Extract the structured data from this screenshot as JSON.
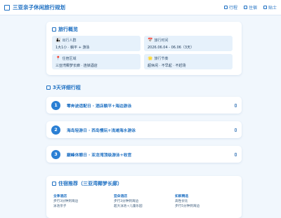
{
  "header": {
    "brand": "三亚亲子休闲旅行规划",
    "nav": [
      {
        "label": "行程"
      },
      {
        "label": "住宿"
      },
      {
        "label": "贴士"
      }
    ]
  },
  "overview": {
    "title": "旅行概览",
    "items": [
      {
        "label": "出行人群",
        "value": "1大1小 · 躺平 + 游泳",
        "icon": "🧑‍🧒"
      },
      {
        "label": "旅行时间",
        "value": "2026.06.04 - 06.06（3天）",
        "icon": "📅"
      },
      {
        "label": "住宿区域",
        "value": "三亚湾椰梦长廊 · 连锁酒店",
        "icon": "📍"
      },
      {
        "label": "旅行节奏",
        "value": "超休闲 · 不早起 · 不赶场",
        "icon": "🌟"
      }
    ]
  },
  "itinerary": {
    "title": "3天详细行程",
    "days": [
      {
        "num": "1",
        "text": "零奔波适配日 · 酒店躺平+海边游泳"
      },
      {
        "num": "2",
        "text": "海岛轻游日 · 西岛慢玩+浅滩海水游泳"
      },
      {
        "num": "3",
        "text": "巅峰休憩日 · 亚龙湾顶级游泳+收官"
      }
    ]
  },
  "hotels": {
    "title": "住宿推荐（三亚湾椰梦长廊）",
    "columns": [
      {
        "name": "全季酒店",
        "line1": "步行3分钟到海边",
        "line2": "泳池亲子"
      },
      {
        "name": "亚朵酒店",
        "line1": "步行3分钟到海边",
        "line2": "超大泳池+儿童乐园"
      },
      {
        "name": "如家精选",
        "line1": "高性价比",
        "line2": "步行5分钟到海边"
      }
    ]
  },
  "colors": {
    "accent": "#1d6fc2",
    "background": "#f1f7fd",
    "info_box": "#e6f1fb",
    "day_badge": "#2a7fd4"
  }
}
